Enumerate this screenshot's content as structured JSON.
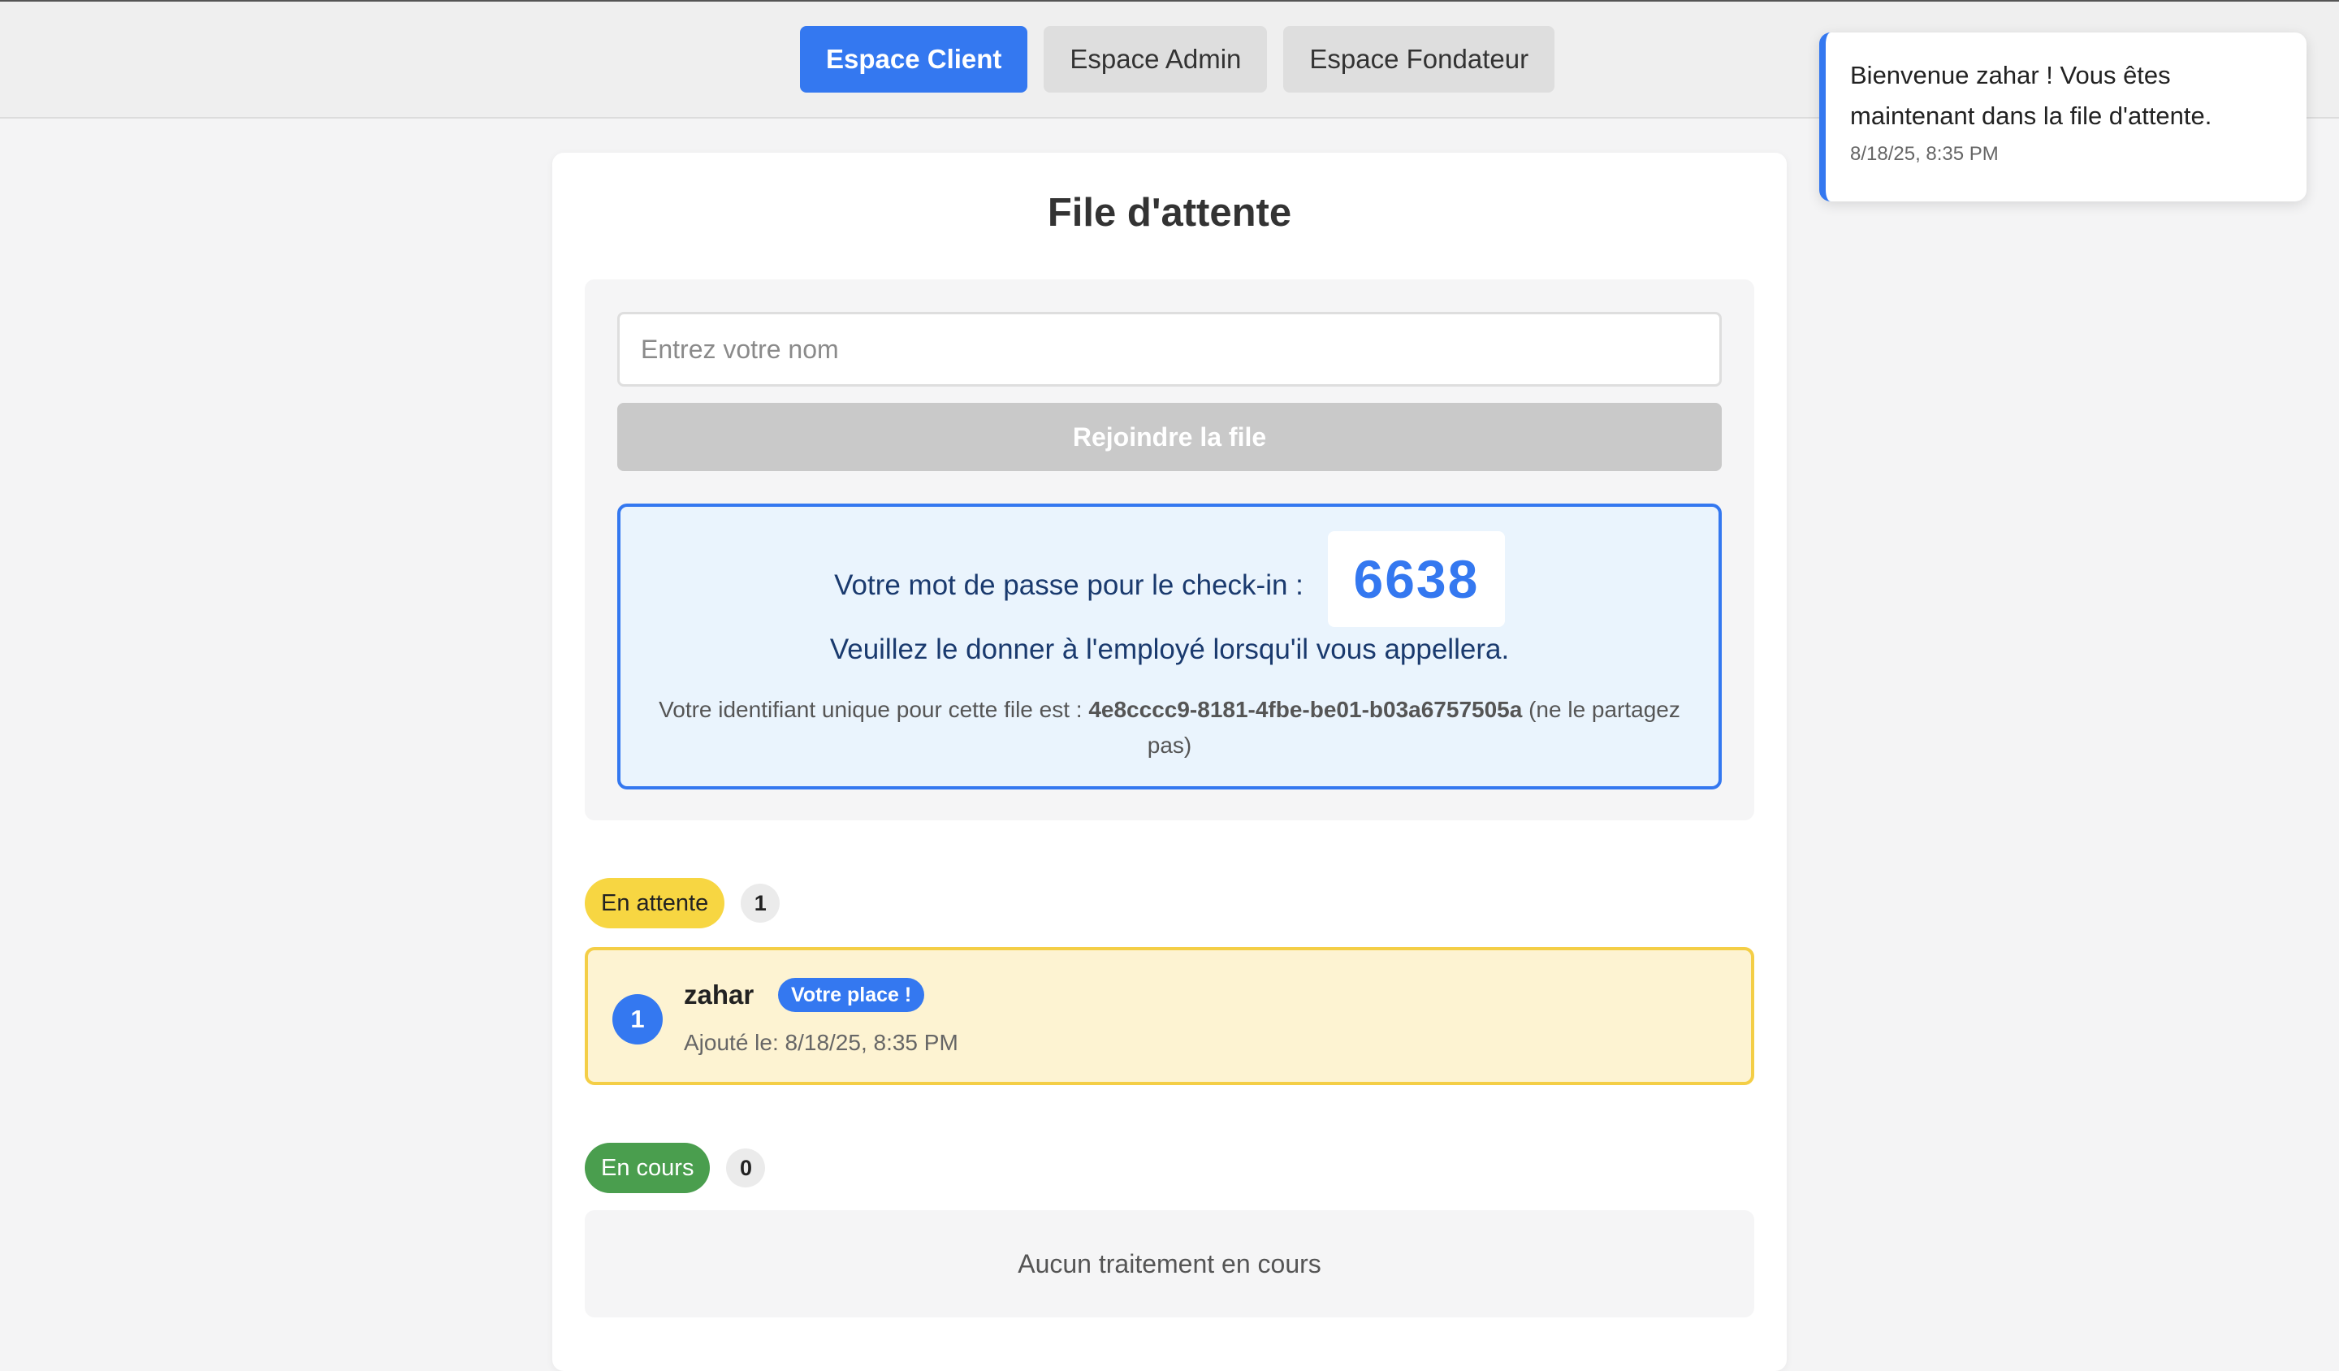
{
  "nav": {
    "client_label": "Espace Client",
    "admin_label": "Espace Admin",
    "founder_label": "Espace Fondateur"
  },
  "toast": {
    "message": "Bienvenue zahar ! Vous êtes maintenant dans la file d'attente.",
    "time": "8/18/25, 8:35 PM"
  },
  "page": {
    "title": "File d'attente"
  },
  "form": {
    "name_placeholder": "Entrez votre nom",
    "name_value": "",
    "join_label": "Rejoindre la file"
  },
  "password_box": {
    "label": "Votre mot de passe pour le check-in :",
    "code": "6638",
    "instruction": "Veuillez le donner à l'employé lorsqu'il vous appellera.",
    "id_prefix": "Votre identifiant unique pour cette file est :",
    "id_value": "4e8cccc9-8181-4fbe-be01-b03a6757505a",
    "id_suffix": "(ne le partagez pas)"
  },
  "waiting": {
    "label": "En attente",
    "count": "1",
    "items": [
      {
        "position": "1",
        "name": "zahar",
        "badge": "Votre place !",
        "added": "Ajouté le: 8/18/25, 8:35 PM"
      }
    ]
  },
  "in_progress": {
    "label": "En cours",
    "count": "0",
    "empty_text": "Aucun traitement en cours"
  },
  "colors": {
    "accent": "#3478f0",
    "waiting": "#f7d642",
    "in_progress": "#4a9e4e",
    "disabled": "#c9c9c9"
  }
}
